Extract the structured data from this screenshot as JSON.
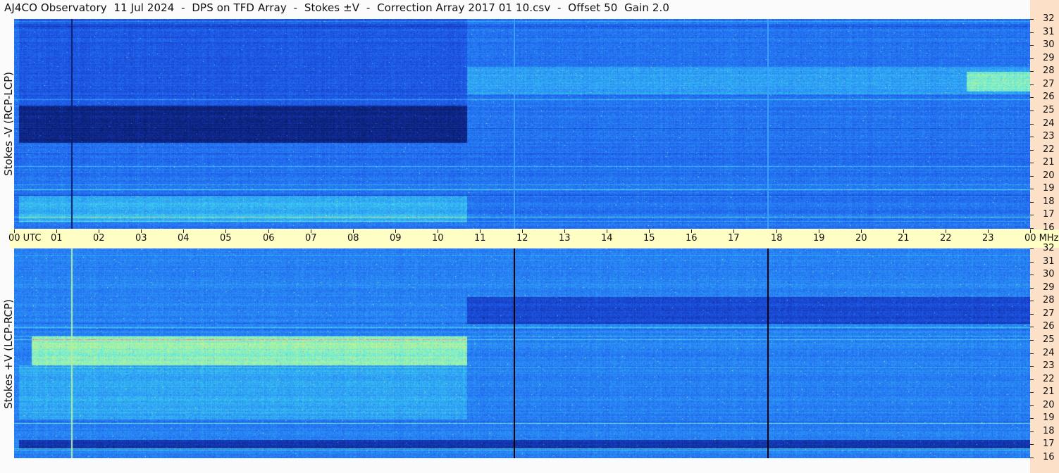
{
  "title": "AJ4CO Observatory  11 Jul 2024  -  DPS on TFD Array  -  Stokes ±V  -  Correction Array 2017 01 10.csv  -  Offset 50  Gain 2.0",
  "colors": {
    "background": "#fbfbfb",
    "time_strip": "#fffec4",
    "freq_strip": "#fde0c8",
    "marker_top": "#3aa0ff",
    "marker_bottom": "#000000",
    "colormap": [
      "#0a1e6e",
      "#1436b4",
      "#1e5aea",
      "#2a8cf6",
      "#38c8f0",
      "#7af0d0",
      "#f0f060",
      "#ff50b4"
    ]
  },
  "chart_data": {
    "type": "heatmap",
    "x_range_utc": [
      0,
      24
    ],
    "y_range_mhz": [
      16,
      32
    ],
    "x_ticks": [
      "00 UTC",
      "01",
      "02",
      "03",
      "04",
      "05",
      "06",
      "07",
      "08",
      "09",
      "10",
      "11",
      "12",
      "13",
      "14",
      "15",
      "16",
      "17",
      "18",
      "19",
      "20",
      "21",
      "22",
      "23",
      "00 MHz"
    ],
    "y_ticks": [
      "32",
      "31",
      "30",
      "29",
      "28",
      "27",
      "26",
      "25",
      "24",
      "23",
      "22",
      "21",
      "20",
      "19",
      "18",
      "17",
      "16"
    ],
    "marker_lines_utc": [
      11.8,
      17.8
    ],
    "panels": [
      {
        "ylabel": "Stokes -V (RCP-LCP)",
        "base_intensity": 0.36,
        "features": [
          {
            "kind": "band",
            "t0": 0.1,
            "t1": 10.7,
            "f0": 22.6,
            "f1": 25.4,
            "level": 0.05
          },
          {
            "kind": "band",
            "t0": 0.1,
            "t1": 10.7,
            "f0": 25.4,
            "f1": 32,
            "level": 0.28
          },
          {
            "kind": "band",
            "t0": 0.1,
            "t1": 10.7,
            "f0": 16.5,
            "f1": 18.5,
            "level": 0.52
          },
          {
            "kind": "band",
            "t0": 10.7,
            "t1": 24,
            "f0": 26.3,
            "f1": 28.4,
            "level": 0.48
          },
          {
            "kind": "band",
            "t0": 22.5,
            "t1": 24,
            "f0": 26.5,
            "f1": 28,
            "level": 0.72
          },
          {
            "kind": "vline",
            "t": 1.35,
            "level": 0.0
          }
        ]
      },
      {
        "ylabel": "Stokes +V (LCP-RCP)",
        "base_intensity": 0.4,
        "features": [
          {
            "kind": "band",
            "t0": 0.4,
            "t1": 10.7,
            "f0": 23.1,
            "f1": 25.3,
            "level": 0.74
          },
          {
            "kind": "band",
            "t0": 0.1,
            "t1": 10.7,
            "f0": 19.0,
            "f1": 23.1,
            "level": 0.5
          },
          {
            "kind": "band",
            "t0": 10.7,
            "t1": 24,
            "f0": 26.3,
            "f1": 28.3,
            "level": 0.22
          },
          {
            "kind": "band",
            "t0": 0.1,
            "t1": 24,
            "f0": 16.8,
            "f1": 17.4,
            "level": 0.12
          },
          {
            "kind": "vline",
            "t": 1.35,
            "level": 0.78
          }
        ]
      }
    ]
  }
}
